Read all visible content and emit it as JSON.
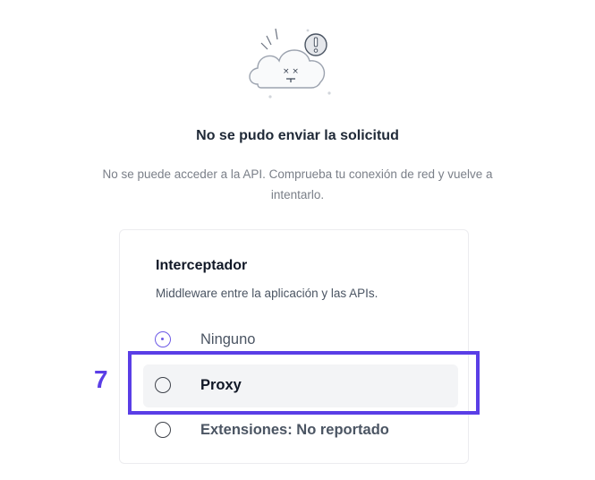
{
  "error": {
    "title": "No se pudo enviar la solicitud",
    "message_line1": "No se puede acceder a la API. Comprueba tu conexión de red y vuelve a",
    "message_line2": "intentarlo.",
    "icon": "sad-cloud-warning-icon"
  },
  "interceptor": {
    "title": "Interceptador",
    "description": "Middleware entre la aplicación y las APIs.",
    "options": [
      {
        "label": "Ninguno",
        "selected": true
      },
      {
        "label": "Proxy",
        "selected": false
      },
      {
        "label": "Extensiones: No reportado",
        "selected": false
      }
    ]
  },
  "annotation": {
    "step_number": "7",
    "color": "#5a3ee6"
  },
  "colors": {
    "accent": "#6d5ae6",
    "text_primary": "#111827",
    "text_muted": "#7a7f88"
  }
}
